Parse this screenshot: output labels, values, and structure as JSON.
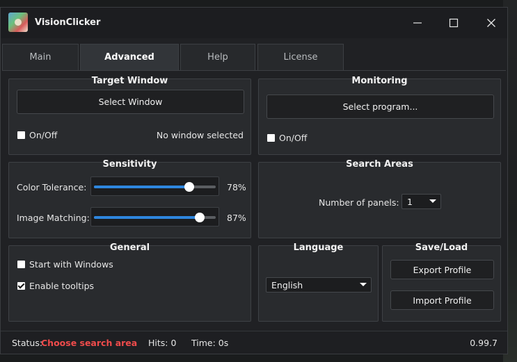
{
  "app": {
    "title": "VisionClicker",
    "accent": "#2e86de",
    "warning_color": "#ef4b4b"
  },
  "tabs": [
    {
      "label": "Main",
      "active": false
    },
    {
      "label": "Advanced",
      "active": true
    },
    {
      "label": "Help",
      "active": false
    },
    {
      "label": "License",
      "active": false
    }
  ],
  "target_window": {
    "title": "Target Window",
    "select_button": "Select Window",
    "toggle_label": "On/Off",
    "toggle_checked": false,
    "status": "No window selected"
  },
  "monitoring": {
    "title": "Monitoring",
    "select_button": "Select program...",
    "toggle_label": "On/Off",
    "toggle_checked": false
  },
  "sensitivity": {
    "title": "Sensitivity",
    "color_tolerance": {
      "label": "Color Tolerance:",
      "value": 78,
      "display": "78%"
    },
    "image_matching": {
      "label": "Image Matching:",
      "value": 87,
      "display": "87%"
    }
  },
  "search_areas": {
    "title": "Search Areas",
    "panels_label": "Number of panels:",
    "panels_value": "1"
  },
  "general": {
    "title": "General",
    "start_with_windows": {
      "label": "Start with Windows",
      "checked": false
    },
    "enable_tooltips": {
      "label": "Enable tooltips",
      "checked": true
    }
  },
  "language": {
    "title": "Language",
    "selected": "English"
  },
  "save_load": {
    "title": "Save/Load",
    "export_button": "Export Profile",
    "import_button": "Import Profile"
  },
  "status": {
    "status_label": "Status:",
    "status_value": "Choose search area",
    "hits": "Hits: 0",
    "time": "Time: 0s",
    "version": "0.99.7"
  },
  "icons": {
    "app": "app-icon",
    "minimize": "minimize-icon",
    "maximize": "maximize-icon",
    "close": "close-icon",
    "dropdown": "chevron-down-icon"
  }
}
